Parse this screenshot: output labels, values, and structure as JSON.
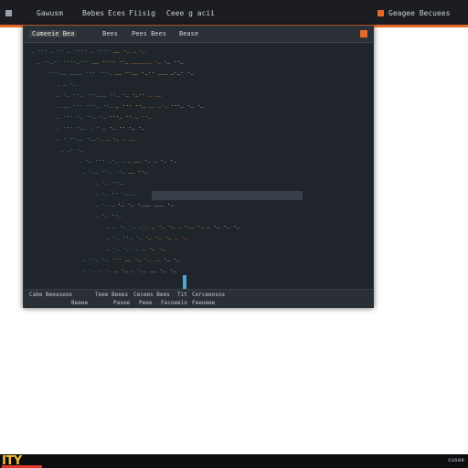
{
  "topbar": {
    "tabs": [
      "Gawusm",
      "Bebes",
      "Eces",
      "Fiisig",
      "Ceee g acii",
      "Geagee Becuees"
    ],
    "accent_color": "#e46a2b"
  },
  "editor": {
    "tabs": [
      "Cumeeie Bea",
      "Bees",
      "Pees Bees",
      "Bease"
    ],
    "code_lines": [
      {
        "g": "_ ... _ .. _ .... _ ....",
        "y": "__ ._ _",
        "o": "._",
        "w": ""
      },
      {
        "g": "_ .._.. ...._...",
        "y": "__ .... .._",
        "o": "______ ._",
        "w": "._ .._"
      },
      {
        "g": "...__ ____ ... ..._",
        "y": "__ ..__ ._.. ___",
        "o": "",
        "w": "_._. ._"
      },
      {
        "g": "_ _ ._",
        "y": "",
        "o": "",
        "w": ""
      },
      {
        "g": "_ ._ .._ ...___ .._",
        "y": "._ ._..",
        "o": "_ __",
        "w": ""
      },
      {
        "g": "_ __ ... ..._ .._",
        "y": "_ ... .._",
        "o": "__ _._",
        "w": "..._ ._ ._"
      },
      {
        "g": "_ ... ._ .._ ._",
        "y": "..._ ..",
        "o": "_ .._",
        "w": ""
      },
      {
        "g": "_ ... .__ _ .",
        "y": "_ ._ ..",
        "o": "",
        "w": "._ ._"
      },
      {
        "g": "_ . ..__ .__._",
        "y": "_ ._",
        "o": "_ __",
        "w": ""
      },
      {
        "g": "_ _. ._",
        "y": "",
        "o": "",
        "w": ""
      },
      {
        "g": "_ ._ ... _._ _",
        "y": "_ __ ._",
        "o": "",
        "w": "_ ._ ._"
      },
      {
        "g": "_ .__ .._ .._",
        "y": "__ .._",
        "o": "",
        "w": ""
      },
      {
        "g": "_ ._ ..__",
        "y": "",
        "o": "",
        "w": ""
      },
      {
        "g": "_ ._ .. .___",
        "y": "",
        "o": "",
        "w": ""
      },
      {
        "g": "_ ._ _",
        "y": "",
        "o": "",
        "w": "._ ._ .___ ___ ._"
      },
      {
        "g": "_ ._ .._",
        "y": "",
        "o": "",
        "w": ""
      },
      {
        "g": "_ _ ._ ._ _._",
        "y": "_ ._ ._",
        "o": "_ .__ ._",
        "w": "_ ._ ._ ._"
      },
      {
        "g": "_ ._ .._ ._",
        "y": "._ ._ ._",
        "o": "_ ._",
        "w": ""
      },
      {
        "g": "_ ._ ._ ._ _",
        "y": "._ ._",
        "o": "",
        "w": ""
      },
      {
        "g": "_ .._ ._ ...",
        "y": "__ ._",
        "o": "._ __",
        "w": "._ ._"
      },
      {
        "g": "_ ._ _ ._",
        "y": "_ ._",
        "o": "_ .__",
        "w": "__ ._ ._"
      }
    ],
    "status": [
      [
        "Cabe Beeaseoo",
        "Teee Beees",
        "Cecees Bees",
        "Tit",
        "Cerceeosos"
      ],
      [
        "Beeee",
        "Pasee",
        "Peee",
        "Fecoeeio",
        "Feeoeee"
      ]
    ]
  },
  "taskbar": {
    "logo_text": "ITY",
    "tray_text": "cusee"
  }
}
